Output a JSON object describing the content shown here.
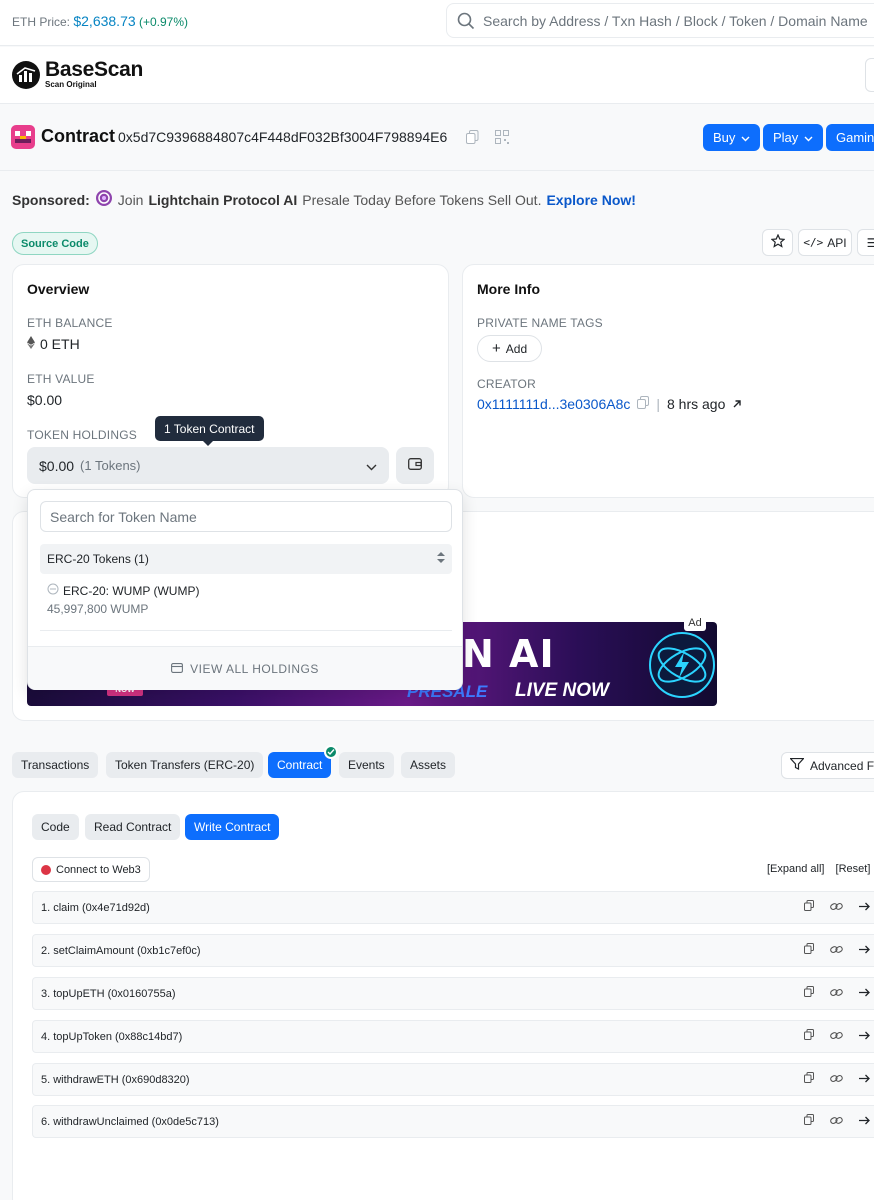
{
  "topbar": {
    "eth_price_label": "ETH Price:",
    "eth_price_value": "$2,638.73",
    "eth_price_change": "(+0.97%)",
    "search_placeholder": "Search by Address / Txn Hash / Block / Token / Domain Name"
  },
  "brand": {
    "name": "BaseScan",
    "tagline": "Scan Original"
  },
  "contract": {
    "label": "Contract",
    "address": "0x5d7C9396884807c4F448dF032Bf3004F798894E6",
    "buttons": [
      "Buy",
      "Play",
      "Gaming"
    ]
  },
  "sponsored": {
    "label": "Sponsored:",
    "text_join": "Join",
    "brand": "Lightchain Protocol AI",
    "text_rest": "Presale Today Before Tokens Sell Out.",
    "cta": "Explore Now!"
  },
  "source_badge": "Source Code",
  "toolbar": {
    "api_label": "API"
  },
  "overview": {
    "title": "Overview",
    "eth_balance_label": "ETH BALANCE",
    "eth_balance_value": "0 ETH",
    "eth_value_label": "ETH VALUE",
    "eth_value_value": "$0.00",
    "token_holdings_label": "TOKEN HOLDINGS",
    "tooltip": "1 Token Contract",
    "holdings_value": "$0.00",
    "holdings_count": "(1 Tokens)"
  },
  "token_dropdown": {
    "search_placeholder": "Search for Token Name",
    "group_label": "ERC-20 Tokens (1)",
    "item_name": "ERC-20: WUMP (WUMP)",
    "item_amount": "45,997,800 WUMP",
    "footer": "VIEW ALL HOLDINGS"
  },
  "more_info": {
    "title": "More Info",
    "private_tags_label": "PRIVATE NAME TAGS",
    "add_label": "Add",
    "creator_label": "CREATOR",
    "creator_address": "0x1111111d...3e0306A8c",
    "creator_age": "8 hrs ago"
  },
  "ad": {
    "tag": "Ad",
    "headline": "N AI",
    "sub_left": "PRESALE",
    "sub_right": "LIVE NOW",
    "left_tag": "NOW"
  },
  "tabs": {
    "items": [
      "Transactions",
      "Token Transfers (ERC-20)",
      "Contract",
      "Events",
      "Assets"
    ],
    "active": "Contract",
    "advanced_filter": "Advanced Filter"
  },
  "contract_tabs": {
    "items": [
      "Code",
      "Read Contract",
      "Write Contract"
    ],
    "active": "Write Contract"
  },
  "write": {
    "connect_label": "Connect to Web3",
    "expand_all": "[Expand all]",
    "reset": "[Reset]",
    "functions": [
      "1. claim (0x4e71d92d)",
      "2. setClaimAmount (0xb1c7ef0c)",
      "3. topUpETH (0x0160755a)",
      "4. topUpToken (0x88c14bd7)",
      "5. withdrawETH (0x690d8320)",
      "6. withdrawUnclaimed (0x0de5c713)"
    ]
  },
  "colors": {
    "accent": "#0d6efd",
    "link": "#0a58ca",
    "success": "#0b8a6a",
    "danger": "#dc3545"
  }
}
